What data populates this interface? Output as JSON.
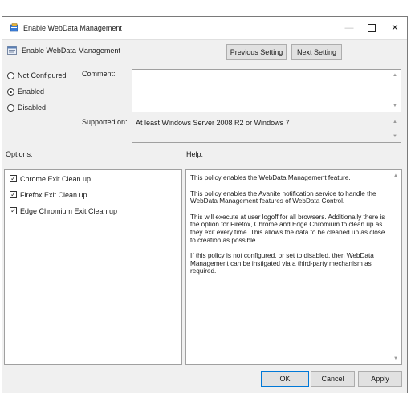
{
  "window": {
    "title": "Enable WebData Management",
    "controls": {
      "minimize": "—",
      "maximize": "□",
      "close": "✕"
    }
  },
  "header": {
    "setting_name": "Enable WebData Management",
    "previous_label": "Previous Setting",
    "next_label": "Next Setting"
  },
  "state": {
    "options": [
      {
        "label": "Not Configured",
        "checked": false
      },
      {
        "label": "Enabled",
        "checked": true
      },
      {
        "label": "Disabled",
        "checked": false
      }
    ]
  },
  "comment": {
    "label": "Comment:",
    "value": ""
  },
  "supported": {
    "label": "Supported on:",
    "value": "At least Windows Server 2008 R2 or Windows 7"
  },
  "options_panel": {
    "label": "Options:",
    "items": [
      {
        "label": "Chrome Exit Clean up",
        "checked": true
      },
      {
        "label": "Firefox Exit Clean up",
        "checked": true
      },
      {
        "label": "Edge Chromium Exit Clean up",
        "checked": true
      }
    ]
  },
  "help_panel": {
    "label": "Help:",
    "paragraphs": [
      "This policy enables the WebData Management feature.",
      "This policy enables the Avanite notification service to handle the WebData Management features of WebData Control.",
      "This will execute at user logoff for all browsers. Additionally there is the option for Firefox, Chrome and Edge Chromium to clean up as they exit every time. This allows the data to be cleaned up as close to creation as possible.",
      "If this policy is not configured, or set to disabled, then WebData Management can be instigated via a third-party mechanism as required."
    ]
  },
  "footer": {
    "ok_label": "OK",
    "cancel_label": "Cancel",
    "apply_label": "Apply"
  },
  "icons": {
    "title": "policy-icon",
    "setting": "setting-icon",
    "scroll_up": "scroll-up-arrow-icon",
    "scroll_down": "scroll-down-arrow-icon"
  },
  "colors": {
    "window_bg": "#f0f0f0",
    "panel_bg": "#ffffff",
    "primary_border": "#0078d7"
  }
}
